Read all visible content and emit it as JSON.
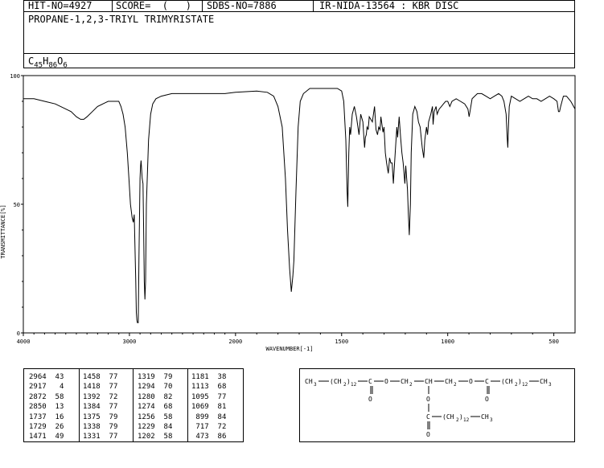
{
  "header": {
    "hit_no": "HIT-NO=4927",
    "score": "SCORE=  (   )",
    "sdbs_no": "SDBS-NO=7886",
    "ir_code": "IR-NIDA-13564 : KBR DISC",
    "compound_name": "PROPANE-1,2,3-TRIYL TRIMYRISTATE",
    "formula": {
      "c": "C",
      "c_count": "45",
      "h": "H",
      "h_count": "86",
      "o": "O",
      "o_count": "6"
    }
  },
  "chart_data": {
    "type": "line",
    "xlabel": "WAVENUMBER[-1]",
    "ylabel": "TRANSMITTANCE[%]",
    "x_ticks": [
      "4000",
      "3000",
      "2000",
      "1500",
      "1000",
      "500"
    ],
    "y_ticks": [
      "100",
      "50",
      "0"
    ],
    "xlim": [
      4000,
      400
    ],
    "ylim": [
      0,
      100
    ],
    "x_scale": "split: linear 4000-2000, then 2000-400 at doubled density",
    "series": [
      {
        "values": [
          [
            4000,
            91
          ],
          [
            3900,
            91
          ],
          [
            3800,
            90
          ],
          [
            3700,
            89
          ],
          [
            3600,
            87
          ],
          [
            3550,
            86
          ],
          [
            3500,
            84
          ],
          [
            3460,
            83
          ],
          [
            3430,
            83
          ],
          [
            3400,
            84
          ],
          [
            3350,
            86
          ],
          [
            3300,
            88
          ],
          [
            3250,
            89
          ],
          [
            3200,
            90
          ],
          [
            3150,
            90
          ],
          [
            3100,
            90
          ],
          [
            3080,
            88
          ],
          [
            3060,
            85
          ],
          [
            3040,
            80
          ],
          [
            3020,
            70
          ],
          [
            3005,
            60
          ],
          [
            2990,
            50
          ],
          [
            2975,
            45
          ],
          [
            2964,
            43
          ],
          [
            2955,
            46
          ],
          [
            2940,
            20
          ],
          [
            2935,
            8
          ],
          [
            2930,
            5
          ],
          [
            2925,
            4
          ],
          [
            2917,
            4
          ],
          [
            2910,
            30
          ],
          [
            2900,
            60
          ],
          [
            2895,
            65
          ],
          [
            2890,
            67
          ],
          [
            2880,
            60
          ],
          [
            2872,
            58
          ],
          [
            2866,
            40
          ],
          [
            2860,
            20
          ],
          [
            2854,
            13
          ],
          [
            2848,
            20
          ],
          [
            2840,
            50
          ],
          [
            2820,
            75
          ],
          [
            2800,
            85
          ],
          [
            2780,
            89
          ],
          [
            2750,
            91
          ],
          [
            2700,
            92
          ],
          [
            2600,
            93
          ],
          [
            2500,
            93
          ],
          [
            2400,
            93
          ],
          [
            2300,
            93
          ],
          [
            2200,
            93
          ],
          [
            2100,
            93
          ],
          [
            2000,
            93.5
          ],
          [
            1900,
            94
          ],
          [
            1850,
            93.5
          ],
          [
            1820,
            92
          ],
          [
            1800,
            88
          ],
          [
            1780,
            80
          ],
          [
            1765,
            60
          ],
          [
            1755,
            40
          ],
          [
            1745,
            25
          ],
          [
            1737,
            16
          ],
          [
            1730,
            22
          ],
          [
            1725,
            28
          ],
          [
            1715,
            55
          ],
          [
            1705,
            80
          ],
          [
            1695,
            90
          ],
          [
            1680,
            93
          ],
          [
            1650,
            95
          ],
          [
            1600,
            95
          ],
          [
            1550,
            95
          ],
          [
            1520,
            95
          ],
          [
            1500,
            94
          ],
          [
            1490,
            90
          ],
          [
            1480,
            75
          ],
          [
            1474,
            55
          ],
          [
            1471,
            49
          ],
          [
            1466,
            70
          ],
          [
            1462,
            80
          ],
          [
            1458,
            77
          ],
          [
            1450,
            85
          ],
          [
            1440,
            88
          ],
          [
            1430,
            84
          ],
          [
            1418,
            77
          ],
          [
            1410,
            85
          ],
          [
            1400,
            82
          ],
          [
            1392,
            72
          ],
          [
            1388,
            76
          ],
          [
            1384,
            77
          ],
          [
            1380,
            80
          ],
          [
            1375,
            79
          ],
          [
            1370,
            84
          ],
          [
            1355,
            82
          ],
          [
            1345,
            88
          ],
          [
            1338,
            79
          ],
          [
            1331,
            77
          ],
          [
            1325,
            80
          ],
          [
            1319,
            79
          ],
          [
            1315,
            84
          ],
          [
            1305,
            78
          ],
          [
            1300,
            80
          ],
          [
            1294,
            70
          ],
          [
            1288,
            66
          ],
          [
            1280,
            62
          ],
          [
            1274,
            68
          ],
          [
            1268,
            66
          ],
          [
            1262,
            66
          ],
          [
            1256,
            58
          ],
          [
            1252,
            64
          ],
          [
            1246,
            72
          ],
          [
            1240,
            80
          ],
          [
            1236,
            76
          ],
          [
            1229,
            84
          ],
          [
            1222,
            76
          ],
          [
            1216,
            70
          ],
          [
            1210,
            66
          ],
          [
            1202,
            58
          ],
          [
            1198,
            65
          ],
          [
            1190,
            56
          ],
          [
            1185,
            45
          ],
          [
            1181,
            38
          ],
          [
            1176,
            50
          ],
          [
            1172,
            70
          ],
          [
            1165,
            85
          ],
          [
            1155,
            88
          ],
          [
            1145,
            86
          ],
          [
            1138,
            82
          ],
          [
            1130,
            80
          ],
          [
            1125,
            76
          ],
          [
            1120,
            72
          ],
          [
            1113,
            68
          ],
          [
            1108,
            75
          ],
          [
            1100,
            80
          ],
          [
            1095,
            77
          ],
          [
            1090,
            82
          ],
          [
            1080,
            85
          ],
          [
            1072,
            88
          ],
          [
            1069,
            81
          ],
          [
            1064,
            86
          ],
          [
            1055,
            88
          ],
          [
            1050,
            85
          ],
          [
            1040,
            87
          ],
          [
            1030,
            88
          ],
          [
            1020,
            89
          ],
          [
            1010,
            90
          ],
          [
            1000,
            90
          ],
          [
            990,
            88
          ],
          [
            980,
            90
          ],
          [
            960,
            91
          ],
          [
            940,
            90
          ],
          [
            920,
            89
          ],
          [
            905,
            87
          ],
          [
            899,
            84
          ],
          [
            893,
            87
          ],
          [
            885,
            91
          ],
          [
            860,
            93
          ],
          [
            840,
            93
          ],
          [
            820,
            92
          ],
          [
            800,
            91
          ],
          [
            780,
            92
          ],
          [
            760,
            93
          ],
          [
            745,
            92
          ],
          [
            735,
            90
          ],
          [
            725,
            85
          ],
          [
            720,
            76
          ],
          [
            717,
            72
          ],
          [
            714,
            80
          ],
          [
            710,
            88
          ],
          [
            700,
            92
          ],
          [
            680,
            91
          ],
          [
            660,
            90
          ],
          [
            640,
            91
          ],
          [
            620,
            92
          ],
          [
            600,
            91
          ],
          [
            580,
            91
          ],
          [
            560,
            90
          ],
          [
            540,
            91
          ],
          [
            520,
            92
          ],
          [
            500,
            91
          ],
          [
            485,
            90
          ],
          [
            478,
            86
          ],
          [
            473,
            86
          ],
          [
            468,
            88
          ],
          [
            455,
            92
          ],
          [
            440,
            92
          ],
          [
            420,
            90
          ],
          [
            400,
            87
          ]
        ]
      }
    ]
  },
  "peak_table": {
    "columns": [
      {
        "wavenumbers": [
          "2964",
          "2917",
          "2872",
          "2850",
          "1737",
          "1729",
          "1471"
        ],
        "transmittance": [
          "43",
          "4",
          "58",
          "13",
          "16",
          "26",
          "49"
        ]
      },
      {
        "wavenumbers": [
          "1458",
          "1418",
          "1392",
          "1384",
          "1375",
          "1338",
          "1331"
        ],
        "transmittance": [
          "77",
          "77",
          "72",
          "77",
          "79",
          "79",
          "77"
        ]
      },
      {
        "wavenumbers": [
          "1319",
          "1294",
          "1280",
          "1274",
          "1256",
          "1229",
          "1202"
        ],
        "transmittance": [
          "79",
          "70",
          "82",
          "68",
          "58",
          "84",
          "58"
        ]
      },
      {
        "wavenumbers": [
          "1181",
          "1113",
          "1095",
          "1069",
          "899",
          "717",
          "473"
        ],
        "transmittance": [
          "38",
          "68",
          "77",
          "81",
          "84",
          "72",
          "86"
        ]
      }
    ]
  },
  "structure": {
    "ch3": "CH",
    "three": "3",
    "ch2_group": "(CH",
    "two": "2",
    "close": ")",
    "twelve": "12",
    "c": "C",
    "o": "O",
    "ch2": "CH",
    "ch": "CH",
    "ch3_end": "CH"
  }
}
